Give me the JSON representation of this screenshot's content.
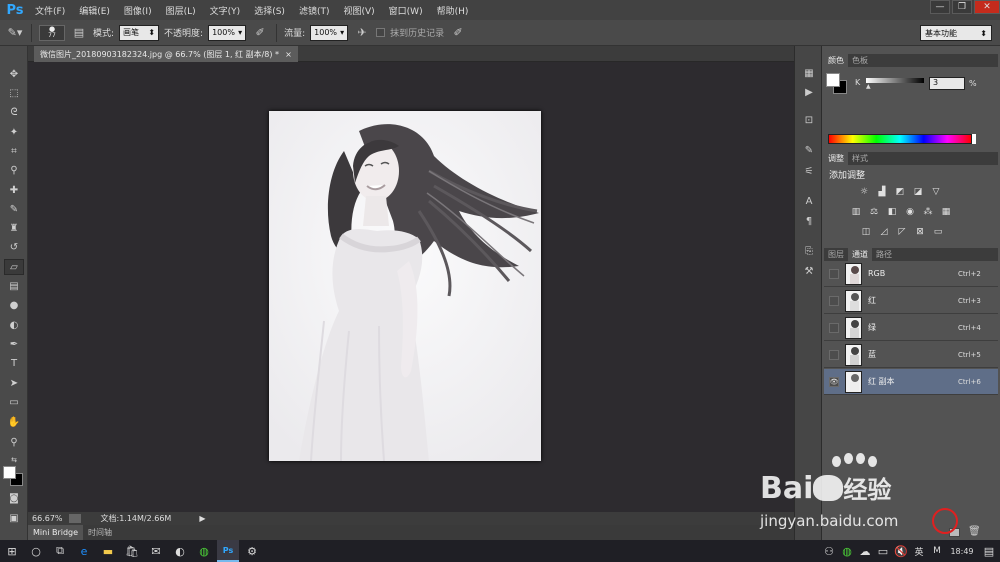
{
  "app": {
    "logo": "Ps"
  },
  "menu": [
    "文件(F)",
    "编辑(E)",
    "图像(I)",
    "图层(L)",
    "文字(Y)",
    "选择(S)",
    "滤镜(T)",
    "视图(V)",
    "窗口(W)",
    "帮助(H)"
  ],
  "window_controls": {
    "minimize": "—",
    "restore": "❐",
    "close": "✕"
  },
  "options": {
    "brush_size": "77",
    "mode_label": "模式:",
    "mode_value": "画笔",
    "opacity_label": "不透明度:",
    "opacity_value": "100%",
    "flow_label": "流量:",
    "flow_value": "100%",
    "history_label": "抹到历史记录"
  },
  "workspace": {
    "value": "基本功能"
  },
  "document_tab": {
    "title": "微信图片_20180903182324.jpg @ 66.7% (图层 1, 红 副本/8) *",
    "close": "×"
  },
  "status": {
    "zoom": "66.67%",
    "doc_size": "文档:1.14M/2.66M"
  },
  "bottom_tabs": [
    "Mini Bridge",
    "时间轴"
  ],
  "color_panel": {
    "tabs": [
      "颜色",
      "色板"
    ],
    "channel_label": "K",
    "value": "3",
    "unit": "%"
  },
  "adjustments_panel": {
    "tabs": [
      "调整",
      "样式"
    ],
    "title": "添加调整"
  },
  "layers_panel": {
    "tabs": [
      "图层",
      "通道",
      "路径"
    ],
    "channels": [
      {
        "name": "RGB",
        "shortcut": "Ctrl+2",
        "visible": false,
        "selected": false
      },
      {
        "name": "红",
        "shortcut": "Ctrl+3",
        "visible": false,
        "selected": false
      },
      {
        "name": "绿",
        "shortcut": "Ctrl+4",
        "visible": false,
        "selected": false
      },
      {
        "name": "蓝",
        "shortcut": "Ctrl+5",
        "visible": false,
        "selected": false
      },
      {
        "name": "红 副本",
        "shortcut": "Ctrl+6",
        "visible": true,
        "selected": true
      }
    ]
  },
  "taskbar": {
    "ime": "英",
    "clock": "18:49"
  },
  "watermark": {
    "brand": "Bai",
    "brand2": "经验",
    "url": "jingyan.baidu.com"
  },
  "colors": {
    "accent": "#31a8ff",
    "selection": "#5f6e88",
    "annotation": "#e02020"
  }
}
